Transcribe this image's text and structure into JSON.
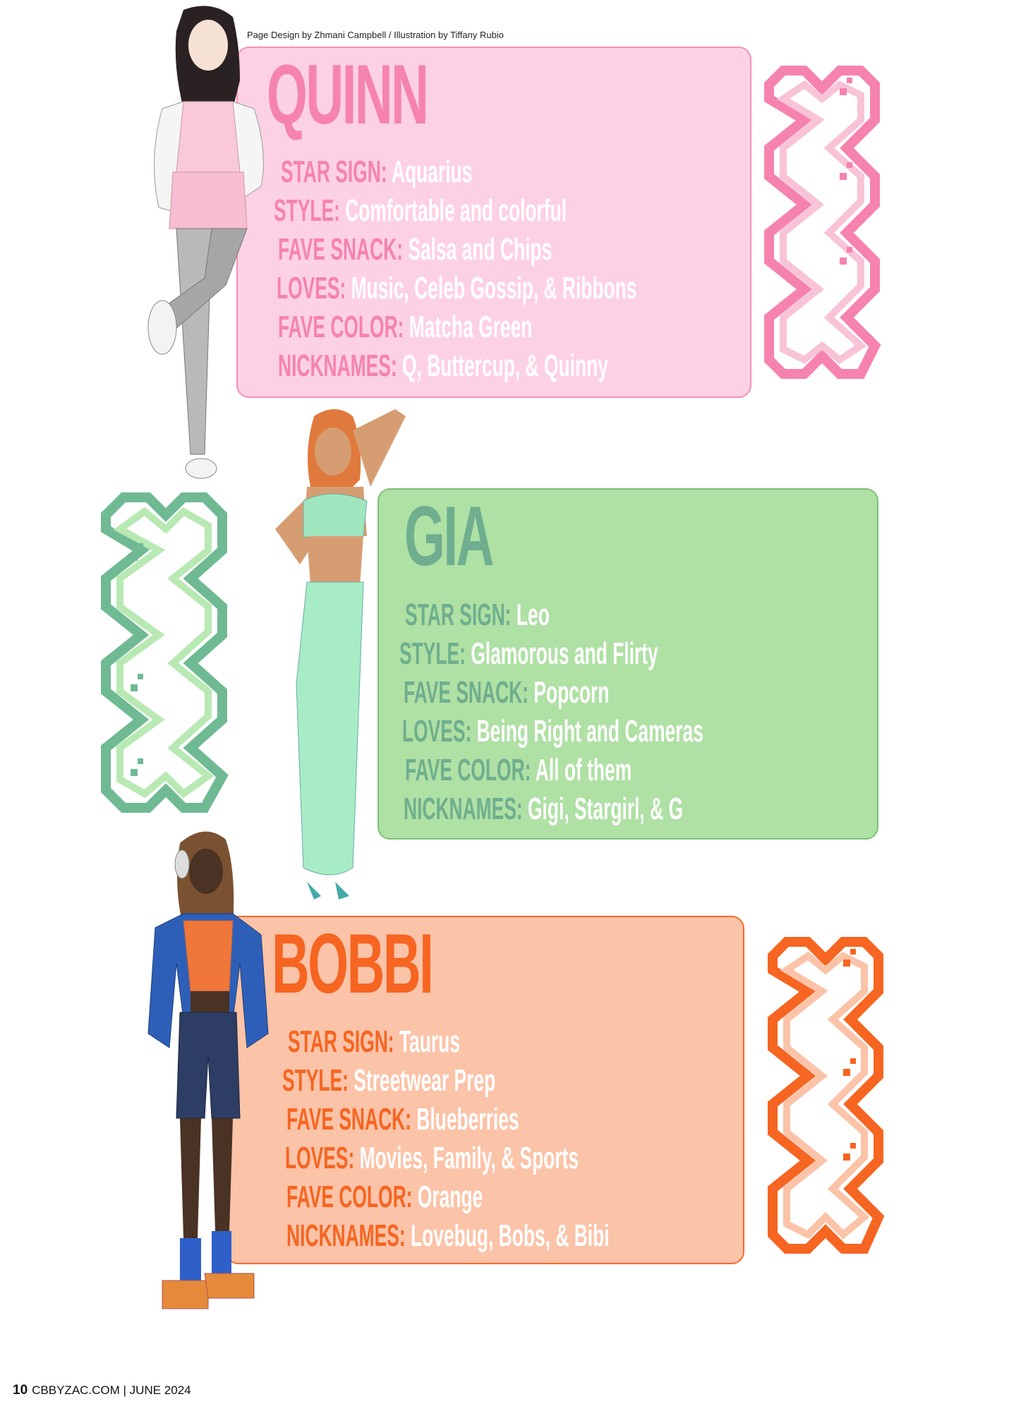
{
  "credit": "Page Design by Zhmani Campbell / Illustration by Tiffany Rubio",
  "colors": {
    "pink_accent": "#f583ae",
    "pink_bg": "#fdd1e5",
    "green_accent": "#6fae8e",
    "green_bg": "#afe0a4",
    "orange_accent": "#f66521",
    "orange_bg": "#fbc3a8"
  },
  "characters": [
    {
      "name": "QUINN",
      "fields": [
        {
          "label": "STAR SIGN:",
          "value": "Aquarius"
        },
        {
          "label": "STYLE:",
          "value": "Comfortable and colorful"
        },
        {
          "label": "FAVE SNACK:",
          "value": "Salsa and Chips"
        },
        {
          "label": "LOVES:",
          "value": "Music, Celeb Gossip, & Ribbons"
        },
        {
          "label": "FAVE COLOR:",
          "value": "Matcha Green"
        },
        {
          "label": "NICKNAMES:",
          "value": "Q, Buttercup, & Quinny"
        }
      ]
    },
    {
      "name": "GIA",
      "fields": [
        {
          "label": "STAR SIGN:",
          "value": "Leo"
        },
        {
          "label": "STYLE:",
          "value": "Glamorous and Flirty"
        },
        {
          "label": "FAVE SNACK:",
          "value": "Popcorn"
        },
        {
          "label": "LOVES:",
          "value": "Being Right and Cameras"
        },
        {
          "label": "FAVE COLOR:",
          "value": "All of them"
        },
        {
          "label": "NICKNAMES:",
          "value": "Gigi, Stargirl, & G"
        }
      ]
    },
    {
      "name": "BOBBI",
      "fields": [
        {
          "label": "STAR SIGN:",
          "value": "Taurus"
        },
        {
          "label": "STYLE:",
          "value": "Streetwear Prep"
        },
        {
          "label": "FAVE SNACK:",
          "value": "Blueberries"
        },
        {
          "label": "LOVES:",
          "value": "Movies, Family, & Sports"
        },
        {
          "label": "FAVE COLOR:",
          "value": "Orange"
        },
        {
          "label": "NICKNAMES:",
          "value": "Lovebug, Bobs, & Bibi"
        }
      ]
    }
  ],
  "footer": {
    "page_number": "10",
    "text": "CBBYZAC.COM | JUNE 2024"
  }
}
